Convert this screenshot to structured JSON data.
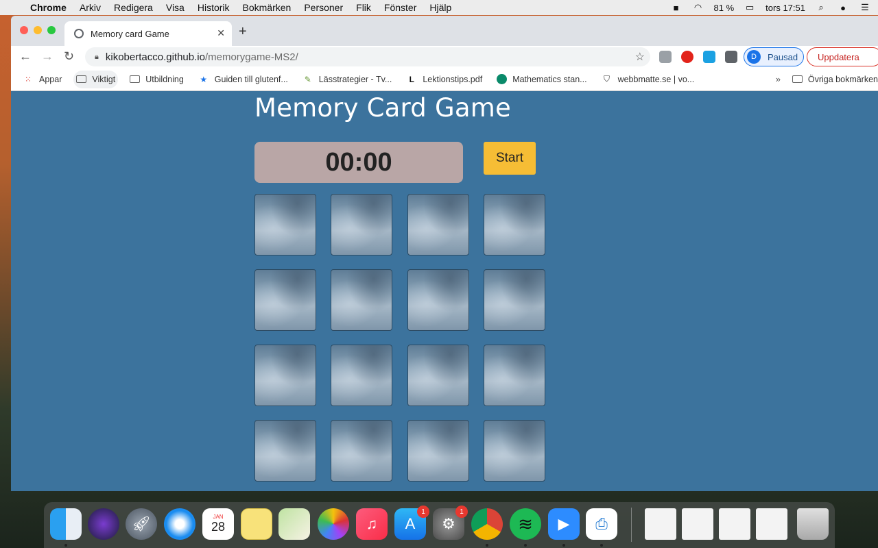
{
  "menubar": {
    "items": [
      "Chrome",
      "Arkiv",
      "Redigera",
      "Visa",
      "Historik",
      "Bokmärken",
      "Personer",
      "Flik",
      "Fönster",
      "Hjälp"
    ],
    "battery": "81 %",
    "clock": "tors 17:51"
  },
  "browser": {
    "tab_title": "Memory card Game",
    "url_host": "kikobertacco.github.io",
    "url_path": "/memorygame-MS2/",
    "profile_initial": "D",
    "profile_label": "Pausad",
    "update_label": "Uppdatera"
  },
  "bookmarks": {
    "items": [
      {
        "label": "Appar",
        "icon": "apps-grid-icon"
      },
      {
        "label": "Viktigt",
        "icon": "folder-icon"
      },
      {
        "label": "Utbildning",
        "icon": "folder-icon"
      },
      {
        "label": "Guiden till glutenf...",
        "icon": "star-icon"
      },
      {
        "label": "Lässtrategier - Tv...",
        "icon": "pencil-icon"
      },
      {
        "label": "Lektionstips.pdf",
        "icon": "lf-icon"
      },
      {
        "label": "Mathematics stan...",
        "icon": "tki-icon"
      },
      {
        "label": "webbmatte.se | vo...",
        "icon": "shield-icon"
      }
    ],
    "other": "Övriga bokmärken"
  },
  "game": {
    "title": "Memory Card Game",
    "timer": "00:00",
    "start_label": "Start",
    "card_rows": 4,
    "card_cols": 4
  },
  "dock": {
    "calendar_month": "JAN",
    "calendar_day": "28",
    "appstore_badge": "1",
    "settings_badge": "1"
  },
  "colors": {
    "page_background": "#3c739d",
    "timer_background": "#b9a6a6",
    "start_button": "#f6bd35"
  }
}
